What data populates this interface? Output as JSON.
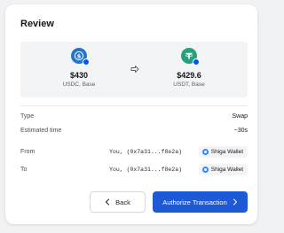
{
  "review": {
    "title": "Review",
    "from_asset": {
      "amount": "$430",
      "label": "USDC, Base",
      "icon": "usdc-coin-icon"
    },
    "to_asset": {
      "amount": "$429.6",
      "label": "USDT, Base",
      "icon": "usdt-coin-icon"
    },
    "details": {
      "type_label": "Type",
      "type_value": "Swap",
      "time_label": "Estimated time",
      "time_value": "~30s",
      "from_label": "From",
      "from_address": "You, (0x7a31...f8e2a)",
      "from_wallet": "Shiga Wallet",
      "to_label": "To",
      "to_address": "You, (0x7a31...f8e2a)",
      "to_wallet": "Shiga Wallet"
    },
    "buttons": {
      "back_label": "Back",
      "authorize_label": "Authorize Transaction"
    },
    "colors": {
      "primary": "#1f5ad6",
      "usdc": "#2775ca",
      "usdt": "#26a17b"
    }
  }
}
